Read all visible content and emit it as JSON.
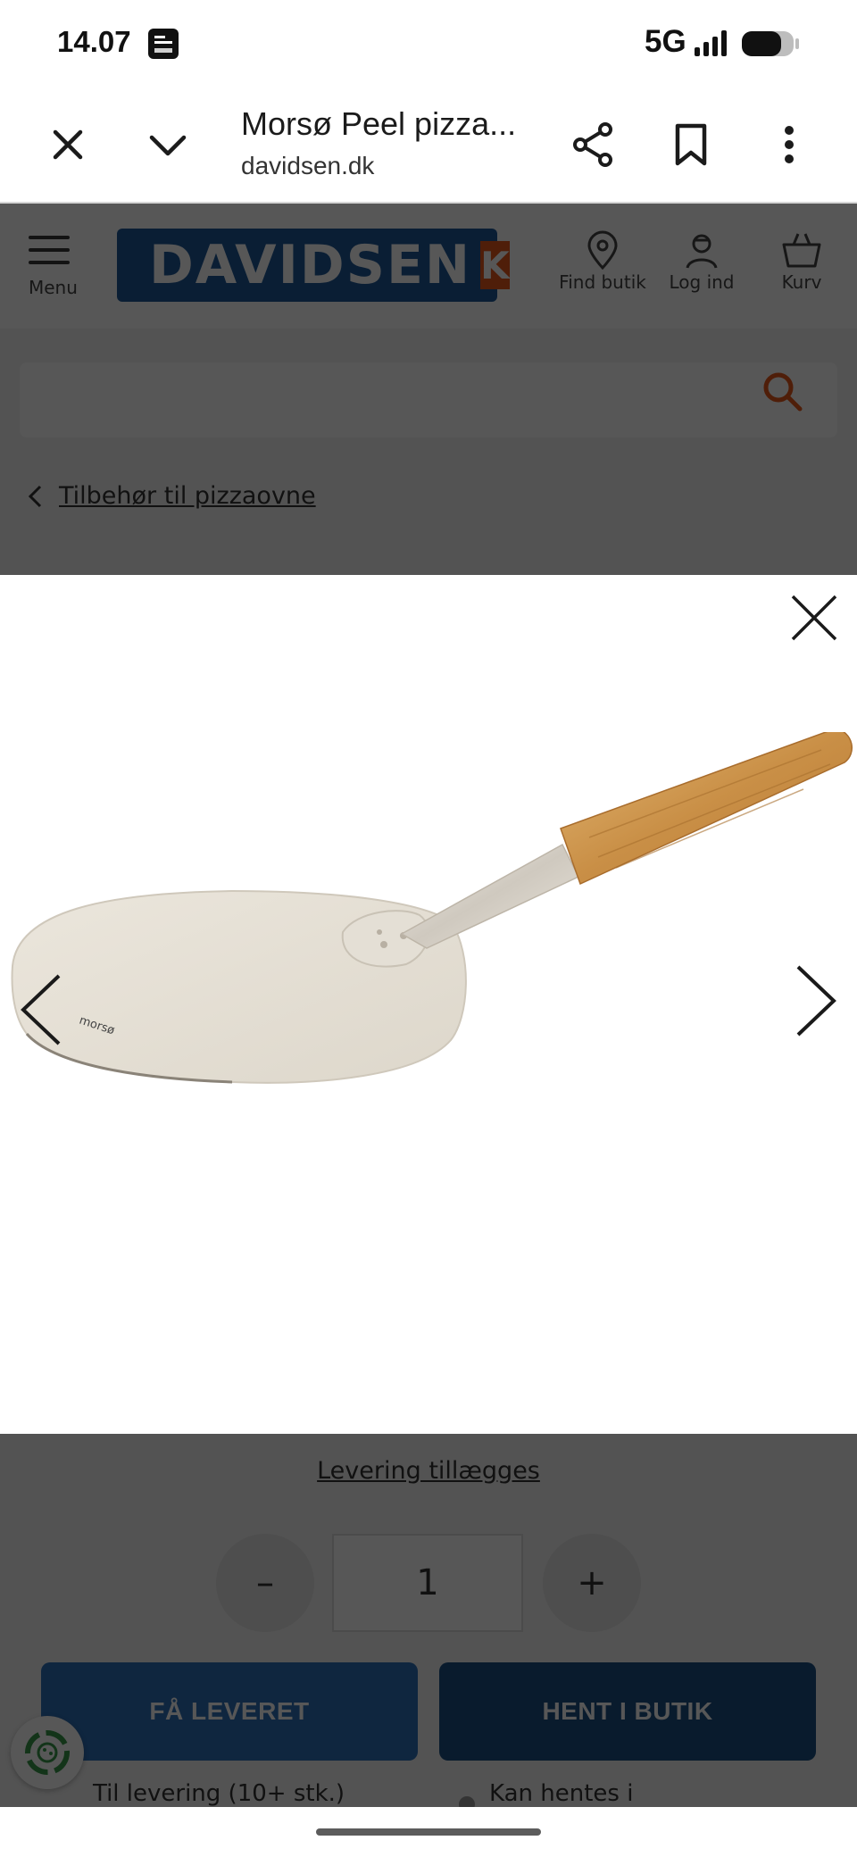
{
  "status_bar": {
    "time": "14.07",
    "network": "5G"
  },
  "browser": {
    "page_title": "Morsø Peel pizza...",
    "domain": "davidsen.dk"
  },
  "site": {
    "logo_text": "DAVIDSEN",
    "logo_mark": "K",
    "menu_label": "Menu",
    "find_store_label": "Find butik",
    "login_label": "Log ind",
    "cart_label": "Kurv",
    "search_placeholder": "",
    "breadcrumb_label": "Tilbehør til pizzaovne",
    "delivery_link": "Levering tillægges",
    "quantity": {
      "minus": "–",
      "value": "1",
      "plus": "+"
    },
    "buttons": {
      "deliver": "FÅ LEVERET",
      "pickup": "HENT I BUTIK"
    },
    "availability": {
      "delivery": "Til levering (10+ stk.)",
      "pickup": "Kan hentes i"
    }
  },
  "lightbox": {
    "product_image_alt": "Morsø Peel pizzaskovl",
    "brand_on_peel": "morsø"
  },
  "colors": {
    "logo_blue": "#1f5a9a",
    "logo_orange": "#e85a1b",
    "deliver_button": "#2c6fb8",
    "pickup_button": "#1b4f84"
  }
}
